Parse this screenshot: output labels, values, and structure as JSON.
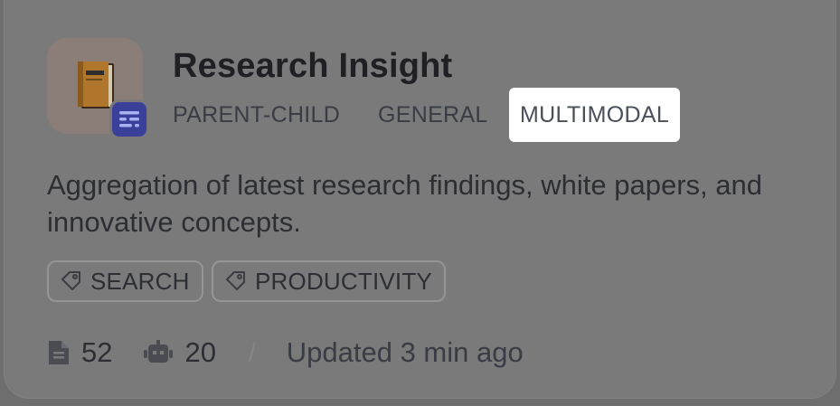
{
  "card": {
    "title": "Research Insight",
    "icon": "book-icon",
    "badge_icon": "document-list-icon",
    "modes": [
      {
        "label": "PARENT-CHILD",
        "selected": false
      },
      {
        "label": "GENERAL",
        "selected": false
      },
      {
        "label": "MULTIMODAL",
        "selected": true
      }
    ],
    "description": "Aggregation of latest research findings, white papers, and innovative concepts.",
    "tags": [
      "SEARCH",
      "PRODUCTIVITY"
    ],
    "stats": {
      "documents": "52",
      "documents_icon": "document-icon",
      "apps": "20",
      "apps_icon": "robot-icon",
      "separator": "/",
      "updated": "Updated 3 min ago"
    }
  },
  "colors": {
    "overlay": "#7a7a7a",
    "badge": "#3a3f9a",
    "highlight": "#ffffff"
  }
}
